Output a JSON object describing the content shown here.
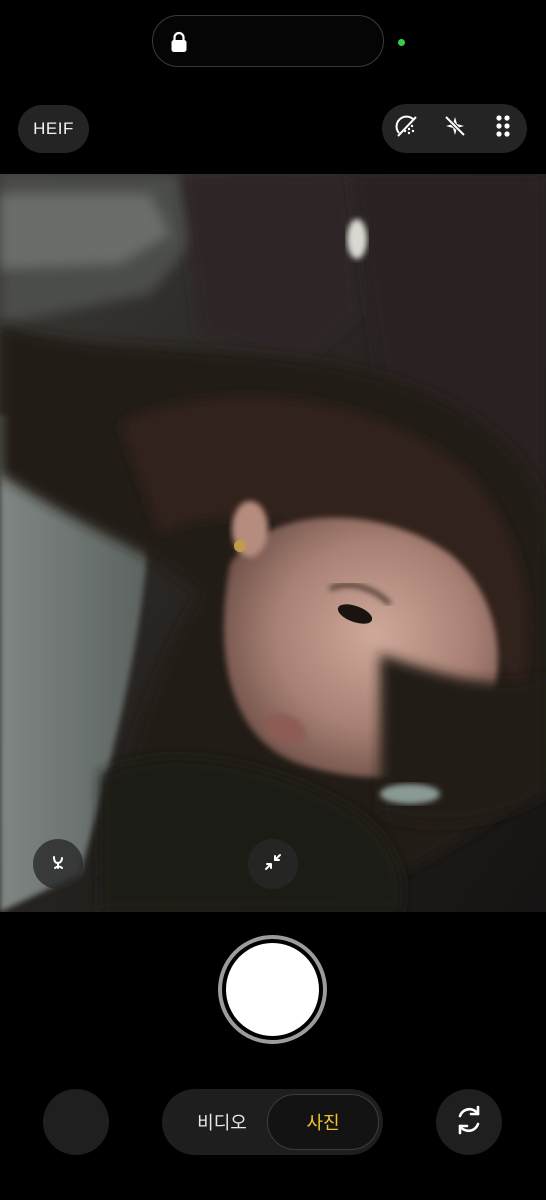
{
  "status": {
    "lock_icon": "lock-icon",
    "indicator_color": "#33d04a"
  },
  "top_controls": {
    "format_label": "HEIF",
    "toolbar_icons": [
      "filter-off-icon",
      "sparkle-off-icon",
      "more-grid-icon"
    ]
  },
  "viewfinder": {
    "left_button_icon": "wide-lens-icon",
    "center_button_icon": "collapse-arrows-icon"
  },
  "shutter": {
    "icon": "shutter-button"
  },
  "modes": {
    "video_label": "비디오",
    "photo_label": "사진",
    "active": "사진",
    "active_color": "#f2c230"
  },
  "bottom": {
    "flip_icon": "switch-camera-icon"
  }
}
